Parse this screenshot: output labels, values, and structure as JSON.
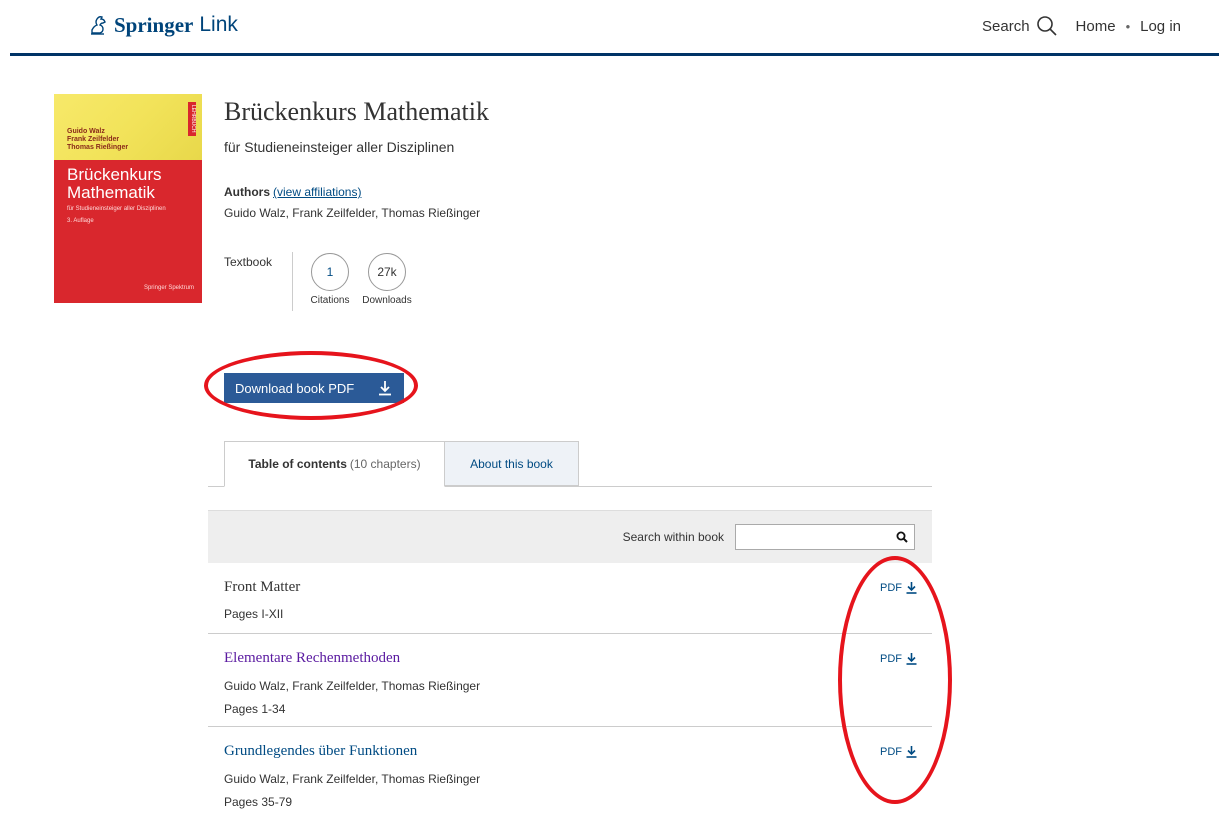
{
  "header": {
    "brand_name": "Springer",
    "brand_suffix": "Link",
    "search_label": "Search",
    "home_label": "Home",
    "separator": "•",
    "login_label": "Log in"
  },
  "cover": {
    "authors": [
      "Guido Walz",
      "Frank Zeilfelder",
      "Thomas Rießinger"
    ],
    "series_label": "LEHRBUCH",
    "title_line1": "Brückenkurs",
    "title_line2": "Mathematik",
    "subtitle": "für Studieneinsteiger aller Disziplinen",
    "edition": "3. Auflage",
    "publisher": "Springer Spektrum"
  },
  "book": {
    "title": "Brückenkurs Mathematik",
    "subtitle": "für Studieneinsteiger aller Disziplinen",
    "authors_label": "Authors",
    "affiliations_link": "(view affiliations)",
    "authors": "Guido Walz, Frank Zeilfelder, Thomas Rießinger",
    "type": "Textbook",
    "citations_value": "1",
    "citations_label": "Citations",
    "downloads_value": "27k",
    "downloads_label": "Downloads"
  },
  "download_button": {
    "label": "Download book PDF"
  },
  "tabs": {
    "toc_label": "Table of contents",
    "toc_count": "(10 chapters)",
    "about_label": "About this book"
  },
  "search_within": {
    "label": "Search within book",
    "value": ""
  },
  "chapters": [
    {
      "title": "Front Matter",
      "authors": "",
      "pages": "Pages I-XII",
      "pdf_label": "PDF"
    },
    {
      "title": "Elementare Rechenmethoden",
      "authors": "Guido Walz, Frank Zeilfelder, Thomas Rießinger",
      "pages": "Pages 1-34",
      "pdf_label": "PDF"
    },
    {
      "title": "Grundlegendes über Funktionen",
      "authors": "Guido Walz, Frank Zeilfelder, Thomas Rießinger",
      "pages": "Pages 35-79",
      "pdf_label": "PDF"
    }
  ],
  "colors": {
    "brand_blue": "#00447a",
    "link_blue": "#004b83",
    "button_blue": "#2b5a97",
    "visited_purple": "#5a1aa0",
    "annotation_red": "#e6141c",
    "cover_red": "#d9272d",
    "cover_yellow": "#f2e35a"
  }
}
